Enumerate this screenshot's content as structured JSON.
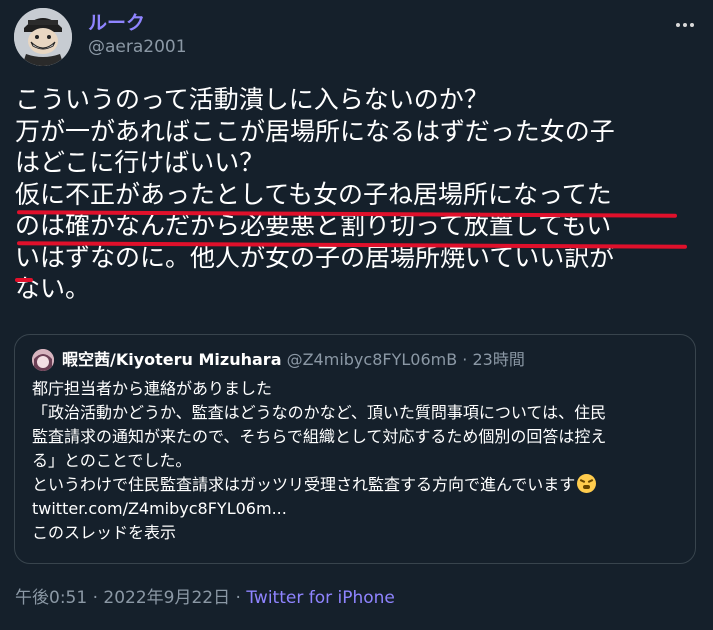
{
  "author": {
    "display_name": "ルーク",
    "handle": "@aera2001"
  },
  "menu": {
    "icon": "more-horizontal-icon"
  },
  "tweet": {
    "lines": [
      "こういうのって活動潰しに入らないのか？",
      "万が一があればここが居場所になるはずだった女の子",
      "はどこに行けばいい？",
      "仮に不正があったとしても女の子ね居場所になってた",
      "のは確かなんだから必要悪と割り切って放置してもい",
      "いはずなのに。他人が女の子の居場所焼いていい訳が",
      "ない。"
    ],
    "underline_color": "#e0102b"
  },
  "quote": {
    "display_name": "暇空茜/Kiyoteru Mizuhara",
    "handle": "@Z4mibyc8FYL06mB",
    "time": "23時間",
    "lines": [
      "都庁担当者から連絡がありました",
      "「政治活動かどうか、監査はどうなのかなど、頂いた質問事項については、住民",
      "監査請求の通知が来たので、そちらで組織として対応するため個別の回答は控え",
      "る」とのことでした。",
      "というわけで住民監査請求はガッツリ受理され監査する方向で進んでいます"
    ],
    "emoji": "face-with-steam-emoji",
    "link": "twitter.com/Z4mibyc8FYL06m...",
    "show_thread": "このスレッドを表示"
  },
  "footer": {
    "time": "午後0:51",
    "date": "2022年9月22日",
    "separator": " · ",
    "source": "Twitter for iPhone"
  },
  "colors": {
    "background": "#15202b",
    "accent": "#8f84ff",
    "muted": "#8b98a5",
    "border": "#38444d"
  }
}
